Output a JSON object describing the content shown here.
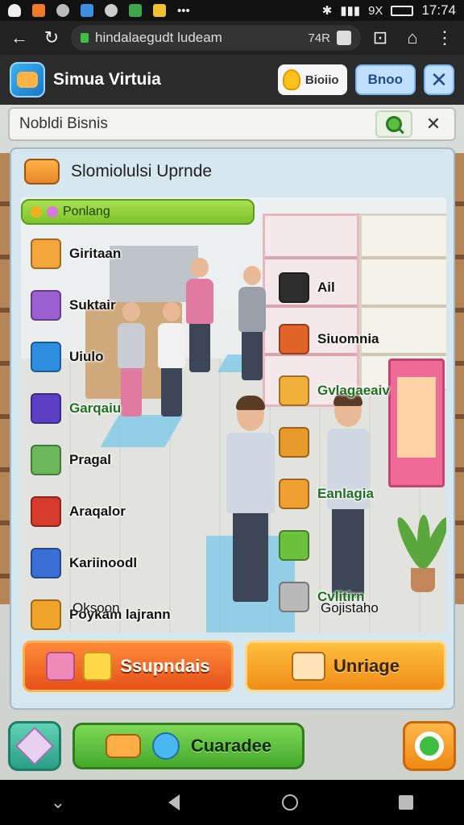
{
  "status_bar": {
    "battery": "9X",
    "time": "17:74"
  },
  "browser": {
    "url": "hindalaegudt ludeam",
    "tab_count": "74R"
  },
  "header": {
    "title": "Simua Virtuia",
    "coin_label": "Bioiio",
    "blue_button": "Bnoo",
    "close_symbol": "✕"
  },
  "search": {
    "label": "Nobldi Bisnis",
    "close_symbol": "✕"
  },
  "panel": {
    "title": "Slomiolulsi Uprnde",
    "tag": "Ponlang",
    "left_items": [
      {
        "label": "Giritaan",
        "icon_color": "#f3a43a"
      },
      {
        "label": "Suktair",
        "icon_color": "#9a5fd1"
      },
      {
        "label": "Uiulo",
        "icon_color": "#2f8de0"
      },
      {
        "label": "Garqaiu",
        "icon_color": "#5b3fc4",
        "green": true
      },
      {
        "label": "Pragal",
        "icon_color": "#6ab85a"
      },
      {
        "label": "Araqalor",
        "icon_color": "#d63a2a"
      },
      {
        "label": "Kariinoodl",
        "icon_color": "#3a6fd6"
      },
      {
        "label": "Poykám lajrann",
        "icon_color": "#f0a42a"
      }
    ],
    "left_sub": "Oksoon",
    "right_items": [
      {
        "label": "Ail",
        "icon_color": "#2d2d2d"
      },
      {
        "label": "Siuomnia",
        "icon_color": "#e0632a"
      },
      {
        "label": "Gvlagaeaiv",
        "icon_color": "#f0b03a",
        "green": true
      },
      {
        "label": "",
        "icon_color": "#e89a2a"
      },
      {
        "label": "Eanlagia",
        "icon_color": "#f0a030",
        "green": true
      },
      {
        "label": "",
        "icon_color": "#6cc23c"
      },
      {
        "label": "Cvlitirn",
        "icon_color": "#b9b9b9",
        "green": true
      }
    ],
    "right_sub": "Gojistaho",
    "supply_button": "Ssupndais",
    "manage_button": "Unriage"
  },
  "bottom": {
    "upgrade_button": "Cuaradee"
  },
  "colors": {
    "accent_green": "#7cc42b",
    "accent_orange": "#f08a14",
    "panel_bg": "#d7e7ef"
  }
}
